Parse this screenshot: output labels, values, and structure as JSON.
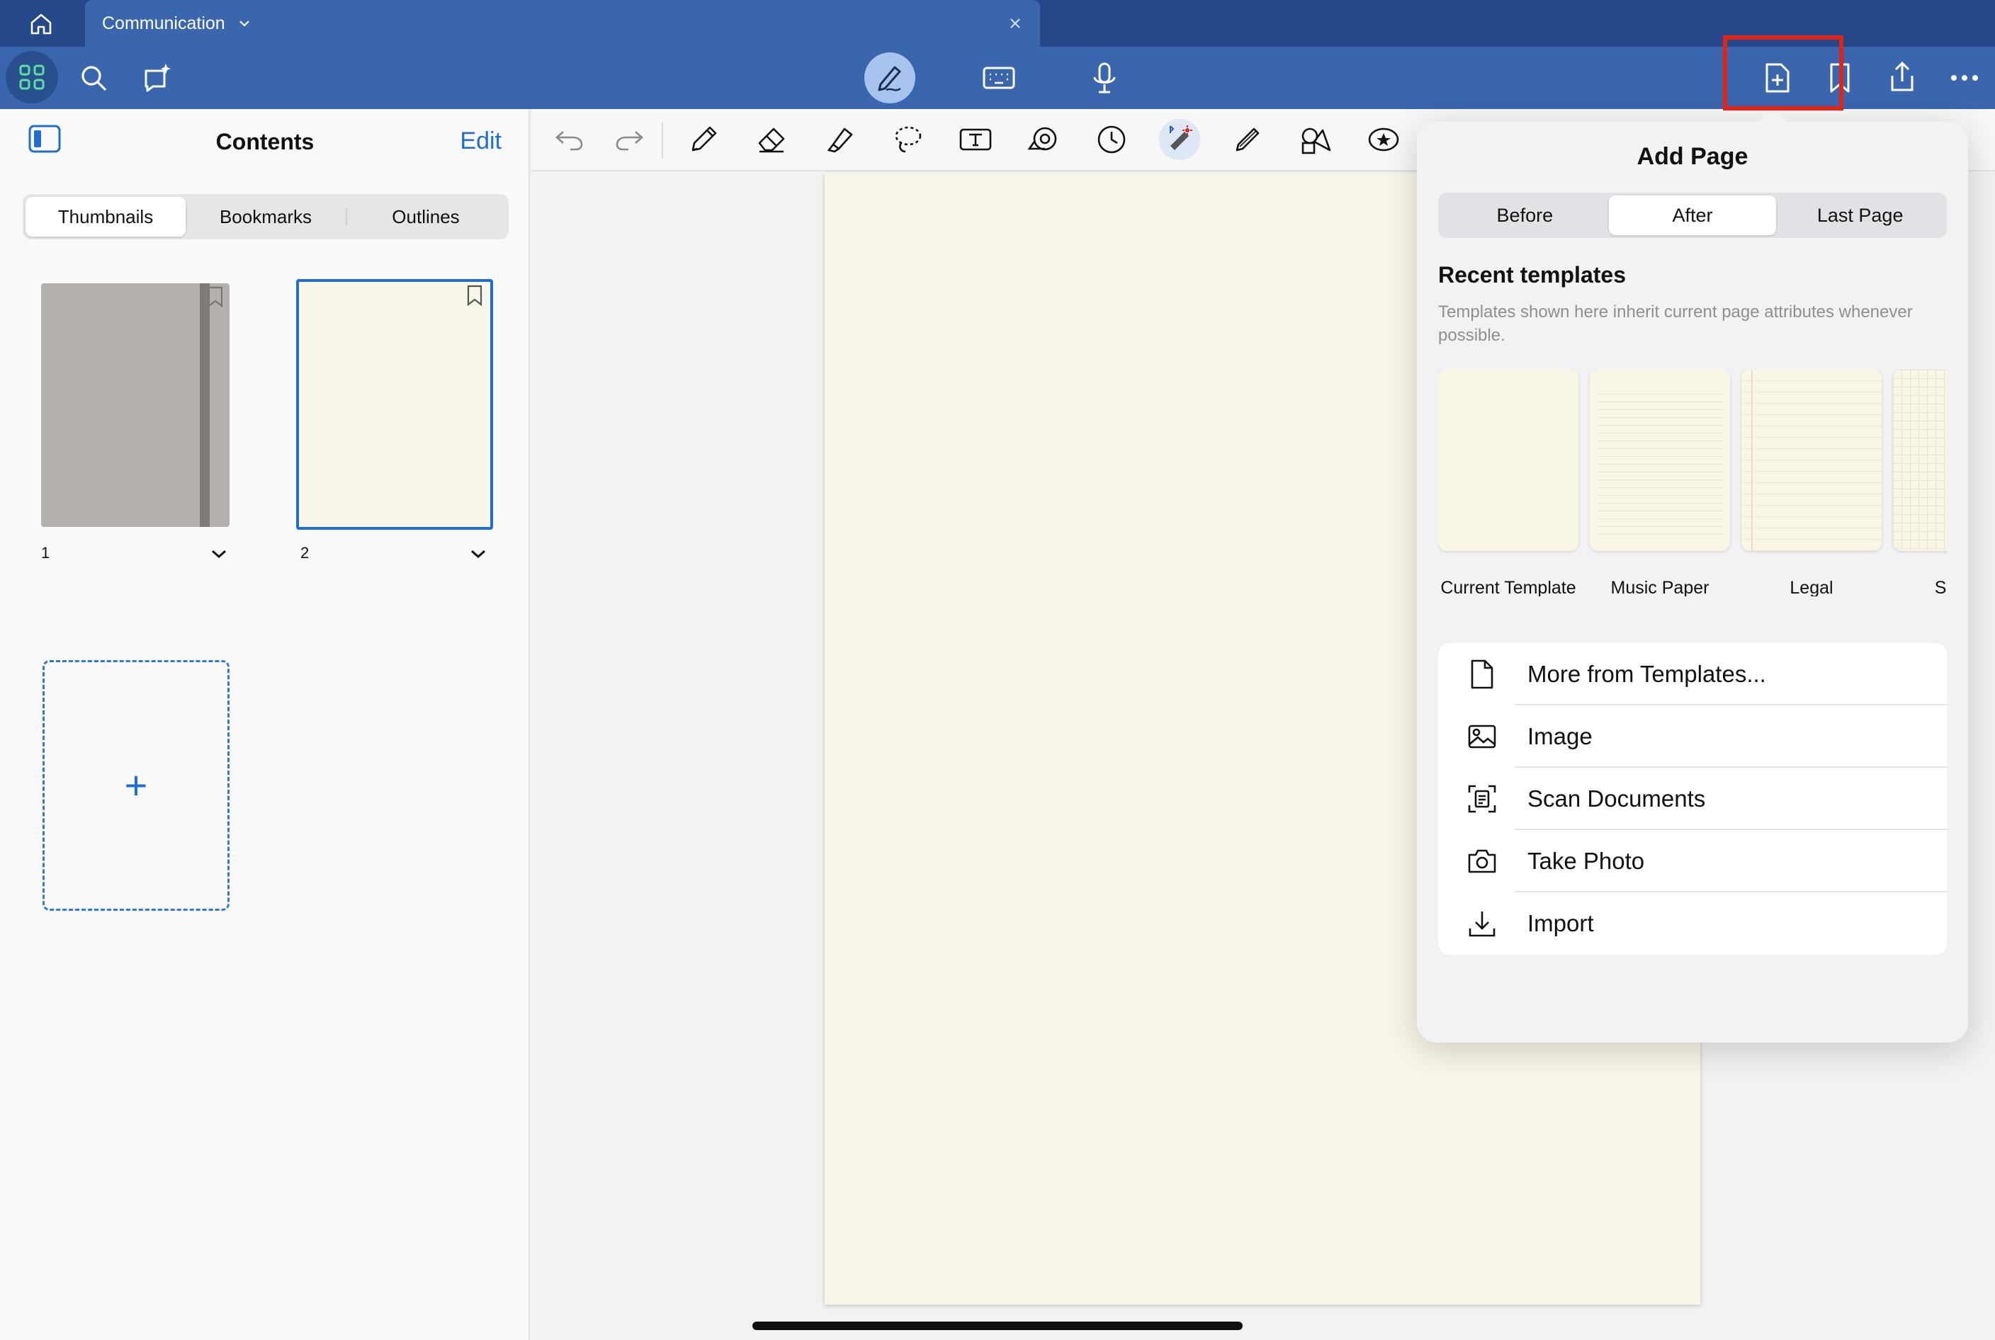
{
  "tab": {
    "title": "Communication"
  },
  "sidebar": {
    "title": "Contents",
    "edit_label": "Edit",
    "segments": [
      "Thumbnails",
      "Bookmarks",
      "Outlines"
    ],
    "active_segment": "Thumbnails",
    "pages": [
      {
        "number": "1"
      },
      {
        "number": "2"
      }
    ],
    "add_page_symbol": "+"
  },
  "popover": {
    "title": "Add Page",
    "segments": [
      "Before",
      "After",
      "Last Page"
    ],
    "active_segment": "After",
    "recent_templates_title": "Recent templates",
    "recent_templates_desc": "Templates shown here inherit current page attributes whenever possible.",
    "templates": [
      {
        "label": "Current Template"
      },
      {
        "label": "Music Paper"
      },
      {
        "label": "Legal"
      },
      {
        "label": "Square"
      }
    ],
    "actions": [
      {
        "label": "More from Templates...",
        "icon": "document-icon"
      },
      {
        "label": "Image",
        "icon": "image-icon"
      },
      {
        "label": "Scan Documents",
        "icon": "scan-icon"
      },
      {
        "label": "Take Photo",
        "icon": "camera-icon"
      },
      {
        "label": "Import",
        "icon": "import-icon"
      }
    ]
  },
  "colors": {
    "tab_bar": "#24488a",
    "toolbar": "#3a66ad",
    "accent": "#1e6fd0",
    "highlight_box": "#e02418",
    "paper": "#f8f6e8"
  }
}
